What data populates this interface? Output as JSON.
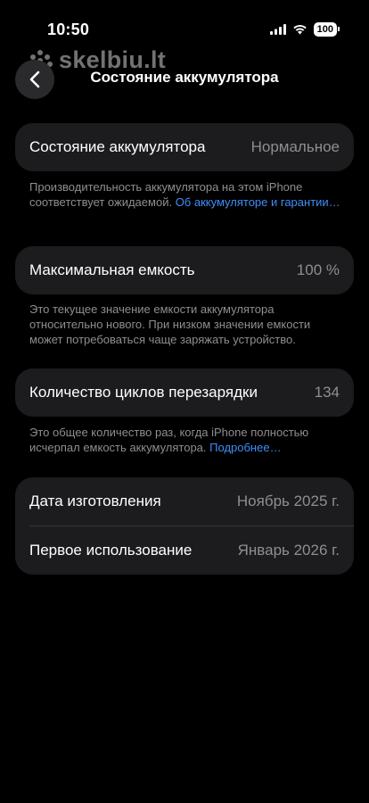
{
  "status_bar": {
    "time": "10:50",
    "battery_level": "100",
    "icons": [
      "cellular-signal-icon",
      "wifi-icon",
      "battery-icon"
    ]
  },
  "watermark": {
    "text": "skelbiu.lt"
  },
  "nav": {
    "title": "Состояние аккумулятора",
    "back_icon": "chevron-left-icon"
  },
  "health": {
    "label": "Состояние аккумулятора",
    "value": "Нормальное",
    "note": "Производительность аккумулятора на этом iPhone соответствует ожидаемой.",
    "link": "Об аккумуляторе и гарантии…"
  },
  "capacity": {
    "label": "Максимальная емкость",
    "value": "100 %",
    "note": "Это текущее значение емкости аккумулятора относительно нового. При низком значении емкости может потребоваться чаще заряжать устройство."
  },
  "cycles": {
    "label": "Количество циклов перезарядки",
    "value": "134",
    "note": "Это общее количество раз, когда iPhone полностью исчерпал емкость аккумулятора.",
    "link": "Подробнее…"
  },
  "dates": {
    "manufacture_label": "Дата изготовления",
    "manufacture_value": "Ноябрь 2025 г.",
    "first_use_label": "Первое использование",
    "first_use_value": "Январь 2026 г."
  },
  "colors": {
    "background": "#000000",
    "card": "#1c1c1e",
    "secondary_text": "#8e8e93",
    "link": "#3e8ef7"
  }
}
